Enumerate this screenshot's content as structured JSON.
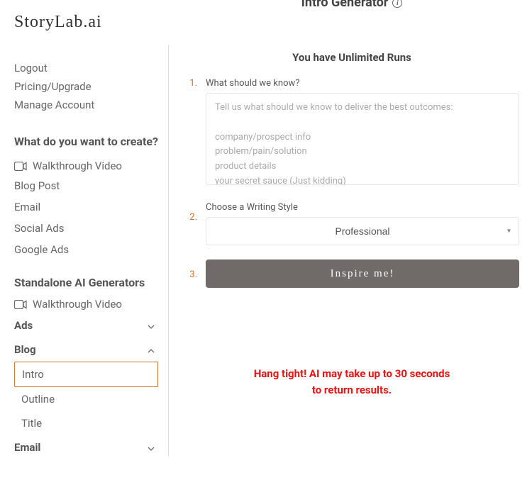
{
  "brand": "StoryLab.ai",
  "nav": {
    "logout": "Logout",
    "pricing": "Pricing/Upgrade",
    "manage": "Manage Account"
  },
  "create": {
    "heading": "What do you want to create?",
    "walkthrough": "Walkthrough Video",
    "items": [
      "Blog Post",
      "Email",
      "Social Ads",
      "Google Ads"
    ]
  },
  "standalone": {
    "heading": "Standalone AI Generators",
    "walkthrough": "Walkthrough Video",
    "categories": {
      "ads": "Ads",
      "blog": "Blog",
      "email": "Email"
    },
    "blog_items": [
      "Intro",
      "Outline",
      "Title"
    ]
  },
  "main": {
    "title": "Intro Generator",
    "runs": "You have Unlimited Runs",
    "step1": {
      "num": "1.",
      "label": "What should we know?",
      "placeholder": "Tell us what should we know to deliver the best outcomes:\n\ncompany/prospect info\nproblem/pain/solution\nproduct details\nyour secret sauce (Just kidding)"
    },
    "step2": {
      "num": "2.",
      "label": "Choose a Writing Style",
      "value": "Professional"
    },
    "step3": {
      "num": "3.",
      "button": "Inspire me!"
    },
    "waiting_l1": "Hang tight! AI may take up to 30 seconds",
    "waiting_l2": "to return results."
  }
}
